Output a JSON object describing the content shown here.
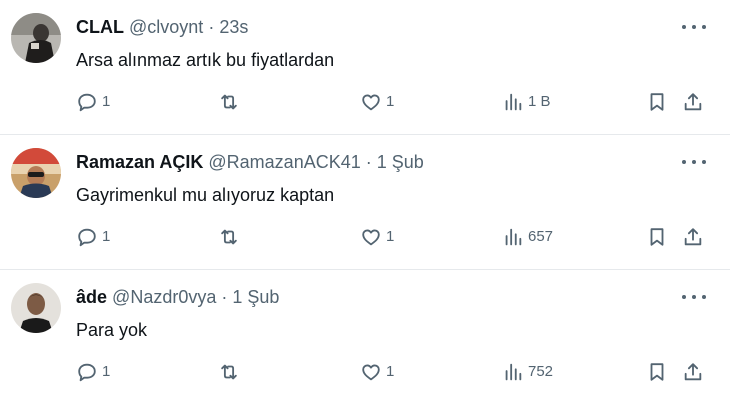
{
  "tweets": [
    {
      "name": "CLAL",
      "handle": "@clvoynt",
      "dot": "·",
      "time": "23s",
      "text": "Arsa alınmaz artık bu fiyatlardan",
      "replies": "1",
      "retweets": "",
      "likes": "1",
      "views": "1 B"
    },
    {
      "name": "Ramazan AÇIK",
      "handle": "@RamazanACK41",
      "dot": "·",
      "time": "1 Şub",
      "text": "Gayrimenkul mu alıyoruz kaptan",
      "replies": "1",
      "retweets": "",
      "likes": "1",
      "views": "657"
    },
    {
      "name": "âde",
      "handle": "@Nazdr0vya",
      "dot": "·",
      "time": "1 Şub",
      "text": "Para yok",
      "replies": "1",
      "retweets": "",
      "likes": "1",
      "views": "752"
    }
  ],
  "colors": {
    "text_primary": "#0f1419",
    "text_secondary": "#536471",
    "divider": "#e6e9ec"
  },
  "icons": [
    "more-icon",
    "reply-icon",
    "retweet-icon",
    "like-icon",
    "views-icon",
    "bookmark-icon",
    "share-icon"
  ]
}
